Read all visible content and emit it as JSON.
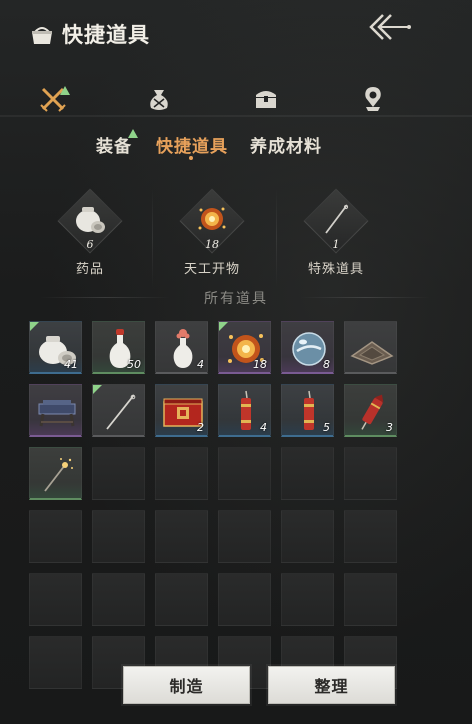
{
  "header": {
    "title": "快捷道具",
    "title_icon": "bag-icon",
    "back_icon": "back-arrow-icon"
  },
  "categories": [
    {
      "icon": "crossed-swords-icon",
      "new": true
    },
    {
      "icon": "pouch-icon",
      "new": false
    },
    {
      "icon": "chest-icon",
      "new": false
    },
    {
      "icon": "location-pin-icon",
      "new": false
    }
  ],
  "subtabs": [
    {
      "label": "装备",
      "active": false,
      "new": true
    },
    {
      "label": "快捷道具",
      "active": true,
      "new": false
    },
    {
      "label": "养成材料",
      "active": false,
      "new": false
    }
  ],
  "featured": [
    {
      "label": "药品",
      "count": "6",
      "icon": "jar-icon"
    },
    {
      "label": "天工开物",
      "count": "18",
      "icon": "firework-burst-icon"
    },
    {
      "label": "特殊道具",
      "count": "1",
      "icon": "needle-icon"
    }
  ],
  "all_items_label": "所有道具",
  "items": [
    {
      "icon": "jar-icon",
      "qty": "41",
      "quality": "blue",
      "new": true
    },
    {
      "icon": "white-vase-red-cap-icon",
      "qty": "50",
      "quality": "green",
      "new": false
    },
    {
      "icon": "white-vase-flower-icon",
      "qty": "4",
      "quality": "gray",
      "new": false
    },
    {
      "icon": "firework-burst-icon",
      "qty": "18",
      "quality": "purple",
      "new": true
    },
    {
      "icon": "crystal-orb-icon",
      "qty": "8",
      "quality": "purple",
      "new": false
    },
    {
      "icon": "mat-frame-icon",
      "qty": "",
      "quality": "gray",
      "new": false
    },
    {
      "icon": "cart-icon",
      "qty": "",
      "quality": "purple",
      "new": false
    },
    {
      "icon": "needle-icon",
      "qty": "",
      "quality": "gray",
      "new": true
    },
    {
      "icon": "red-gift-box-icon",
      "qty": "2",
      "quality": "blue",
      "new": false
    },
    {
      "icon": "red-firecracker-icon",
      "qty": "4",
      "quality": "blue",
      "new": false
    },
    {
      "icon": "red-firecracker-icon",
      "qty": "5",
      "quality": "blue",
      "new": false
    },
    {
      "icon": "red-rocket-icon",
      "qty": "3",
      "quality": "green",
      "new": false
    },
    {
      "icon": "sparkler-icon",
      "qty": "",
      "quality": "green",
      "new": false
    }
  ],
  "buttons": {
    "craft": "制造",
    "sort": "整理"
  },
  "colors": {
    "accent": "#e7a15b",
    "new_marker": "#8fd38a"
  }
}
